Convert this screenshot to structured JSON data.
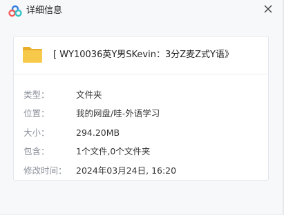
{
  "window": {
    "title": "详细信息",
    "icons": {
      "app": "baidu-netdisk-cloud-icon",
      "close": "close-icon"
    }
  },
  "file": {
    "icon": "folder-icon",
    "name": "[ WY10036英Y男SKevin：3分Z麦Z式Y语》"
  },
  "properties": [
    {
      "label": "类型：",
      "value": "文件夹"
    },
    {
      "label": "位置：",
      "value": "我的网盘/哇-外语学习"
    },
    {
      "label": "大小：",
      "value": "294.20MB"
    },
    {
      "label": "包含：",
      "value": "1个文件,0个文件夹"
    },
    {
      "label": "修改时间：",
      "value": "2024年03月24日, 16:20"
    }
  ],
  "colors": {
    "folder": "#f5c242",
    "cloud_blue": "#2f7de1",
    "cloud_red": "#f25a5a",
    "cloud_teal": "#35c2c4"
  }
}
